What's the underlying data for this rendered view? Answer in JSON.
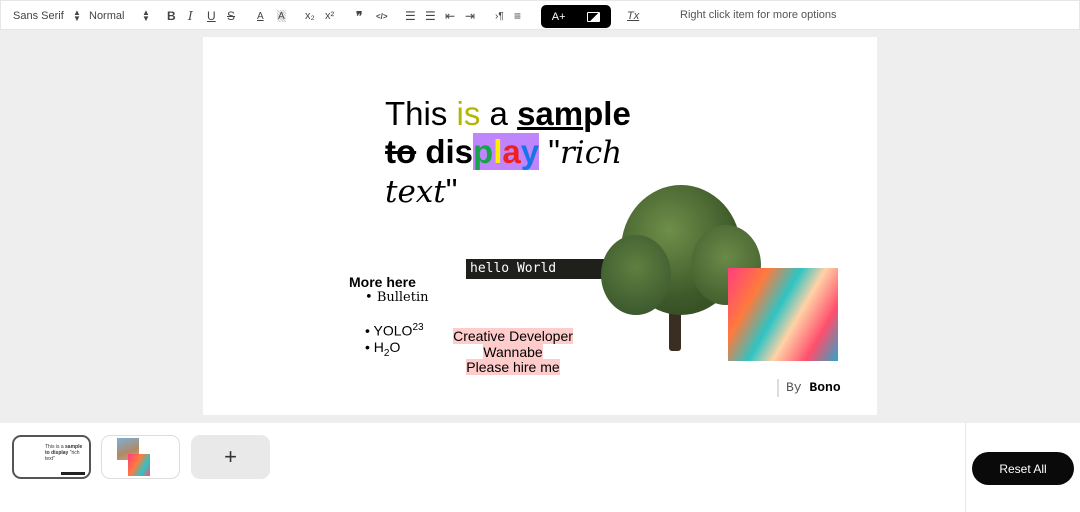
{
  "toolbar": {
    "font": "Sans Serif",
    "size": "Normal",
    "bold": "B",
    "italic": "I",
    "underline": "U",
    "strike": "S",
    "color": "A",
    "background": "A",
    "subscript": "x₂",
    "superscript": "x²",
    "blockquote": "❞",
    "code": "</>",
    "font_size_button": "A+",
    "clear_format": "Tx",
    "hint": "Right click item for more options"
  },
  "doc": {
    "line1": {
      "a": "This ",
      "b": "is",
      "c": " a ",
      "d": "sam",
      "e": "ple"
    },
    "line2": {
      "strike": "to",
      "dis": " dis",
      "p": "p",
      "l": "l",
      "a": "a",
      "y": "y",
      "q": " \"",
      "rich": "rich"
    },
    "line3": {
      "text": "text",
      "q": "\""
    },
    "colors": {
      "is": "#b5b500",
      "highlight": "#c084fc",
      "p": "#16a34a",
      "l": "#ffee00",
      "a": "#ef2020",
      "y": "#1a73e8"
    },
    "more_heading": "More here",
    "bullets": [
      {
        "text": "Bulletin"
      },
      {
        "text": "YOLO",
        "sup": "23"
      },
      {
        "text": "H",
        "sub": "2",
        "after": "O"
      }
    ],
    "code": "hello World",
    "creative": [
      "Creative Developer",
      "Wannabe",
      "Please hire me"
    ],
    "by": "By",
    "author": "Bono"
  },
  "bottom": {
    "add": "+",
    "reset": "Reset All"
  }
}
